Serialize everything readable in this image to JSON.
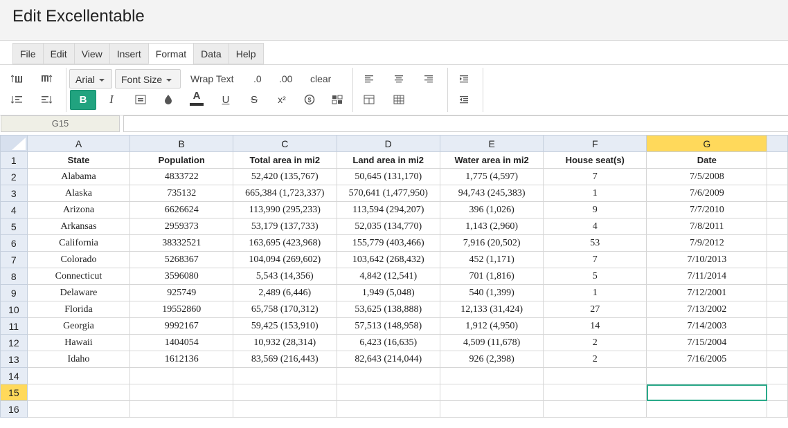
{
  "window": {
    "title": "Edit Excellentable"
  },
  "menu": {
    "items": [
      "File",
      "Edit",
      "View",
      "Insert",
      "Format",
      "Data",
      "Help"
    ],
    "active": "Format"
  },
  "toolbar": {
    "font_name": "Arial",
    "font_size_label": "Font Size",
    "wrap_text_label": "Wrap Text",
    "decimal_decrease_label": ".0",
    "decimal_increase_label": ".00",
    "clear_label": "clear",
    "bold_label": "B",
    "italic_label": "I",
    "text_color_label": "A",
    "underline_label": "U",
    "strike_label": "S",
    "superscript_label": "x²",
    "accent_color": "#21a37f"
  },
  "name_box": {
    "value": "G15"
  },
  "formula_bar": {
    "value": ""
  },
  "sheet": {
    "column_headers": [
      "A",
      "B",
      "C",
      "D",
      "E",
      "F",
      "G"
    ],
    "row_numbers": [
      "1",
      "2",
      "3",
      "4",
      "5",
      "6",
      "7",
      "8",
      "9",
      "10",
      "11",
      "12",
      "13",
      "14",
      "15",
      "16"
    ],
    "selected_column": "G",
    "selected_row": "15",
    "header_row": [
      "State",
      "Population",
      "Total area in mi2",
      "Land area in mi2",
      "Water area in mi2",
      "House seat(s)",
      "Date"
    ],
    "rows": [
      [
        "Alabama",
        "4833722",
        "52,420 (135,767)",
        "50,645 (131,170)",
        "1,775 (4,597)",
        "7",
        "7/5/2008"
      ],
      [
        "Alaska",
        "735132",
        "665,384 (1,723,337)",
        "570,641 (1,477,950)",
        "94,743 (245,383)",
        "1",
        "7/6/2009"
      ],
      [
        "Arizona",
        "6626624",
        "113,990 (295,233)",
        "113,594 (294,207)",
        "396 (1,026)",
        "9",
        "7/7/2010"
      ],
      [
        "Arkansas",
        "2959373",
        "53,179 (137,733)",
        "52,035 (134,770)",
        "1,143 (2,960)",
        "4",
        "7/8/2011"
      ],
      [
        "California",
        "38332521",
        "163,695 (423,968)",
        "155,779 (403,466)",
        "7,916 (20,502)",
        "53",
        "7/9/2012"
      ],
      [
        "Colorado",
        "5268367",
        "104,094 (269,602)",
        "103,642 (268,432)",
        "452 (1,171)",
        "7",
        "7/10/2013"
      ],
      [
        "Connecticut",
        "3596080",
        "5,543 (14,356)",
        "4,842 (12,541)",
        "701 (1,816)",
        "5",
        "7/11/2014"
      ],
      [
        "Delaware",
        "925749",
        "2,489 (6,446)",
        "1,949 (5,048)",
        "540 (1,399)",
        "1",
        "7/12/2001"
      ],
      [
        "Florida",
        "19552860",
        "65,758 (170,312)",
        "53,625 (138,888)",
        "12,133 (31,424)",
        "27",
        "7/13/2002"
      ],
      [
        "Georgia",
        "9992167",
        "59,425 (153,910)",
        "57,513 (148,958)",
        "1,912 (4,950)",
        "14",
        "7/14/2003"
      ],
      [
        "Hawaii",
        "1404054",
        "10,932 (28,314)",
        "6,423 (16,635)",
        "4,509 (11,678)",
        "2",
        "7/15/2004"
      ],
      [
        "Idaho",
        "1612136",
        "83,569 (216,443)",
        "82,643 (214,044)",
        "926 (2,398)",
        "2",
        "7/16/2005"
      ]
    ]
  }
}
